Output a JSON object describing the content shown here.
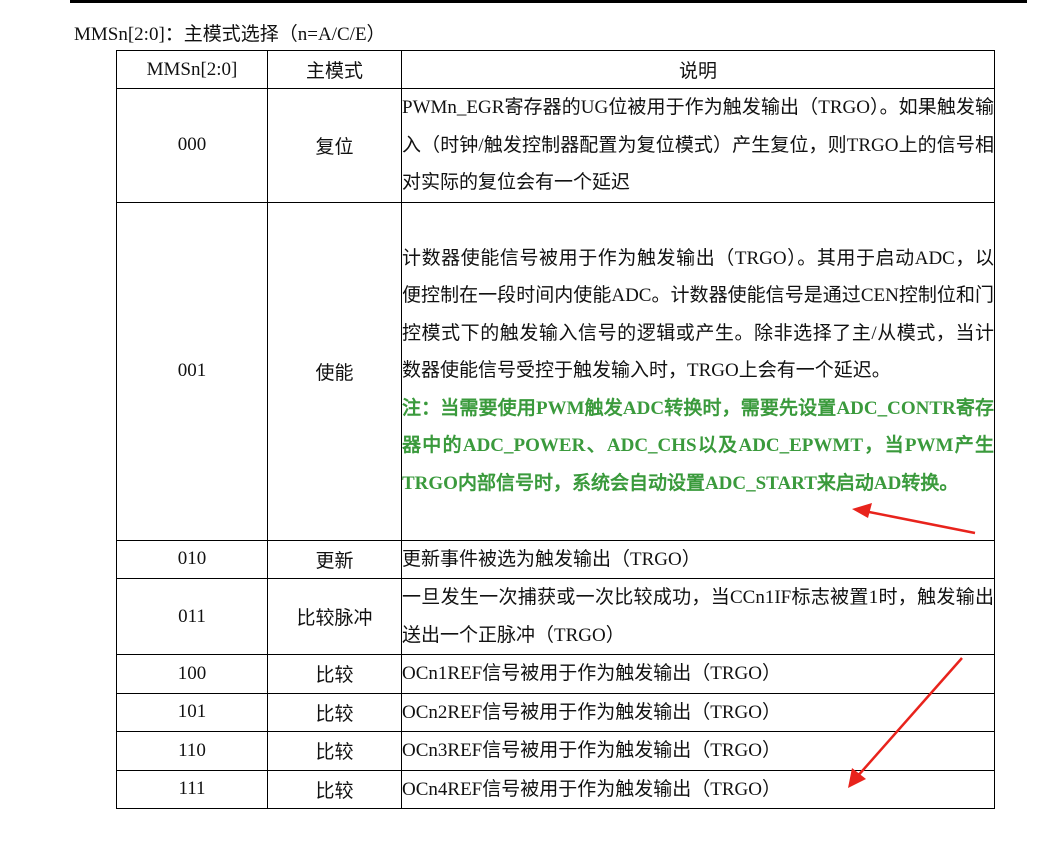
{
  "caption": "MMSn[2:0]：主模式选择（n=A/C/E）",
  "table": {
    "headers": [
      "MMSn[2:0]",
      "主模式",
      "说明"
    ],
    "rows": [
      {
        "code": "000",
        "mode": "复位",
        "desc": "PWMn_EGR寄存器的UG位被用于作为触发输出（TRGO）。如果触发输入（时钟/触发控制器配置为复位模式）产生复位，则TRGO上的信号相对实际的复位会有一个延迟"
      },
      {
        "code": "001",
        "mode": "使能",
        "desc": "计数器使能信号被用于作为触发输出（TRGO）。其用于启动ADC，以便控制在一段时间内使能ADC。计数器使能信号是通过CEN控制位和门控模式下的触发输入信号的逻辑或产生。除非选择了主/从模式，当计数器使能信号受控于触发输入时，TRGO上会有一个延迟。",
        "note": "注：当需要使用PWM触发ADC转换时，需要先设置ADC_CONTR寄存器中的ADC_POWER、ADC_CHS以及ADC_EPWMT，当PWM产生TRGO内部信号时，系统会自动设置ADC_START来启动AD转换。"
      },
      {
        "code": "010",
        "mode": "更新",
        "desc": "更新事件被选为触发输出（TRGO）"
      },
      {
        "code": "011",
        "mode": "比较脉冲",
        "desc": "一旦发生一次捕获或一次比较成功，当CCn1IF标志被置1时，触发输出送出一个正脉冲（TRGO）"
      },
      {
        "code": "100",
        "mode": "比较",
        "desc": "OCn1REF信号被用于作为触发输出（TRGO）"
      },
      {
        "code": "101",
        "mode": "比较",
        "desc": "OCn2REF信号被用于作为触发输出（TRGO）"
      },
      {
        "code": "110",
        "mode": "比较",
        "desc": "OCn3REF信号被用于作为触发输出（TRGO）"
      },
      {
        "code": "111",
        "mode": "比较",
        "desc": "OCn4REF信号被用于作为触发输出（TRGO）"
      }
    ]
  },
  "colors": {
    "note": "#3a9a3c",
    "arrow": "#e8231c",
    "border": "#000000"
  },
  "annotations": [
    "red-arrow-pointing-at-note",
    "red-arrow-pointing-at-row-111"
  ]
}
